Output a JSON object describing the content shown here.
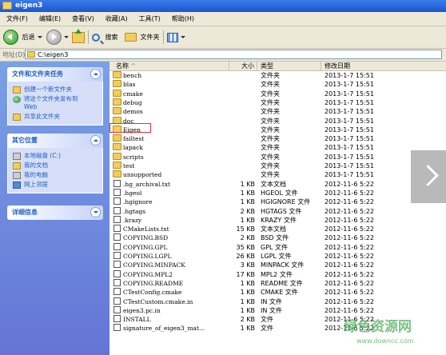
{
  "window": {
    "title": "eigen3"
  },
  "menu": [
    "文件(F)",
    "编辑(E)",
    "查看(V)",
    "收藏(A)",
    "工具(T)",
    "帮助(H)"
  ],
  "toolbar": {
    "back_label": "后退",
    "search_label": "搜索",
    "folders_label": "文件夹"
  },
  "address": {
    "label": "地址(D)",
    "value": "C:\\eigen3"
  },
  "sidebar": {
    "tasks": {
      "title": "文件和文件夹任务",
      "items": [
        "创建一个新文件夹",
        "将这个文件夹发布到",
        "Web",
        "共享此文件夹"
      ]
    },
    "places": {
      "title": "其它位置",
      "items": [
        "本地磁盘 (C:)",
        "我的文档",
        "我的电脑",
        "网上邻居"
      ]
    },
    "details": {
      "title": "详细信息"
    }
  },
  "columns": {
    "name": "名称",
    "size": "大小",
    "type": "类型",
    "date": "修改日期"
  },
  "files": [
    {
      "name": "bench",
      "size": "",
      "type": "文件夹",
      "date": "2013-1-7 15:51",
      "kind": "folder"
    },
    {
      "name": "blas",
      "size": "",
      "type": "文件夹",
      "date": "2013-1-7 15:51",
      "kind": "folder"
    },
    {
      "name": "cmake",
      "size": "",
      "type": "文件夹",
      "date": "2013-1-7 15:51",
      "kind": "folder"
    },
    {
      "name": "debug",
      "size": "",
      "type": "文件夹",
      "date": "2013-1-7 15:51",
      "kind": "folder"
    },
    {
      "name": "demos",
      "size": "",
      "type": "文件夹",
      "date": "2013-1-7 15:51",
      "kind": "folder"
    },
    {
      "name": "doc",
      "size": "",
      "type": "文件夹",
      "date": "2013-1-7 15:51",
      "kind": "folder"
    },
    {
      "name": "Eigen",
      "size": "",
      "type": "文件夹",
      "date": "2013-1-7 15:51",
      "kind": "folder"
    },
    {
      "name": "failtest",
      "size": "",
      "type": "文件夹",
      "date": "2013-1-7 15:51",
      "kind": "folder"
    },
    {
      "name": "lapack",
      "size": "",
      "type": "文件夹",
      "date": "2013-1-7 15:51",
      "kind": "folder"
    },
    {
      "name": "scripts",
      "size": "",
      "type": "文件夹",
      "date": "2013-1-7 15:51",
      "kind": "folder"
    },
    {
      "name": "test",
      "size": "",
      "type": "文件夹",
      "date": "2013-1-7 15:51",
      "kind": "folder"
    },
    {
      "name": "unsupported",
      "size": "",
      "type": "文件夹",
      "date": "2013-1-7 15:51",
      "kind": "folder"
    },
    {
      "name": ".hg_archival.txt",
      "size": "1 KB",
      "type": "文本文档",
      "date": "2012-11-6 5:22",
      "kind": "file"
    },
    {
      "name": ".hgeol",
      "size": "1 KB",
      "type": "HGEOL 文件",
      "date": "2012-11-6 5:22",
      "kind": "file"
    },
    {
      "name": ".hgignore",
      "size": "1 KB",
      "type": "HGIGNORE 文件",
      "date": "2012-11-6 5:22",
      "kind": "file"
    },
    {
      "name": ".hgtags",
      "size": "2 KB",
      "type": "HGTAGS 文件",
      "date": "2012-11-6 5:22",
      "kind": "file"
    },
    {
      "name": ".krazy",
      "size": "1 KB",
      "type": "KRAZY 文件",
      "date": "2012-11-6 5:22",
      "kind": "file"
    },
    {
      "name": "CMakeLists.txt",
      "size": "15 KB",
      "type": "文本文档",
      "date": "2012-11-6 5:22",
      "kind": "file"
    },
    {
      "name": "COPYING.BSD",
      "size": "2 KB",
      "type": "BSD 文件",
      "date": "2012-11-6 5:22",
      "kind": "file"
    },
    {
      "name": "COPYING.GPL",
      "size": "35 KB",
      "type": "GPL 文件",
      "date": "2012-11-6 5:22",
      "kind": "file"
    },
    {
      "name": "COPYING.LGPL",
      "size": "26 KB",
      "type": "LGPL 文件",
      "date": "2012-11-6 5:22",
      "kind": "file"
    },
    {
      "name": "COPYING.MINPACK",
      "size": "3 KB",
      "type": "MINPACK 文件",
      "date": "2012-11-6 5:22",
      "kind": "file"
    },
    {
      "name": "COPYING.MPL2",
      "size": "17 KB",
      "type": "MPL2 文件",
      "date": "2012-11-6 5:22",
      "kind": "file"
    },
    {
      "name": "COPYING.README",
      "size": "1 KB",
      "type": "README 文件",
      "date": "2012-11-6 5:22",
      "kind": "file"
    },
    {
      "name": "CTestConfig.cmake",
      "size": "1 KB",
      "type": "CMAKE 文件",
      "date": "2012-11-6 5:22",
      "kind": "file"
    },
    {
      "name": "CTestCustom.cmake.in",
      "size": "1 KB",
      "type": "IN 文件",
      "date": "2012-11-6 5:22",
      "kind": "file"
    },
    {
      "name": "eigen3.pc.in",
      "size": "1 KB",
      "type": "IN 文件",
      "date": "2012-11-6 5:22",
      "kind": "file"
    },
    {
      "name": "INSTALL",
      "size": "2 KB",
      "type": "文件",
      "date": "2012-11-6 5:22",
      "kind": "file"
    },
    {
      "name": "signature_of_eigen3_mat...",
      "size": "1 KB",
      "type": "文件",
      "date": "2012-11-6 5:22",
      "kind": "file"
    }
  ],
  "watermark": {
    "text": "绿色资源网",
    "url": "www.downcc.com"
  },
  "colors": {
    "title_bar": "#1b56d3",
    "sidebar": "#6375d6",
    "highlight_box": "#e03030"
  }
}
